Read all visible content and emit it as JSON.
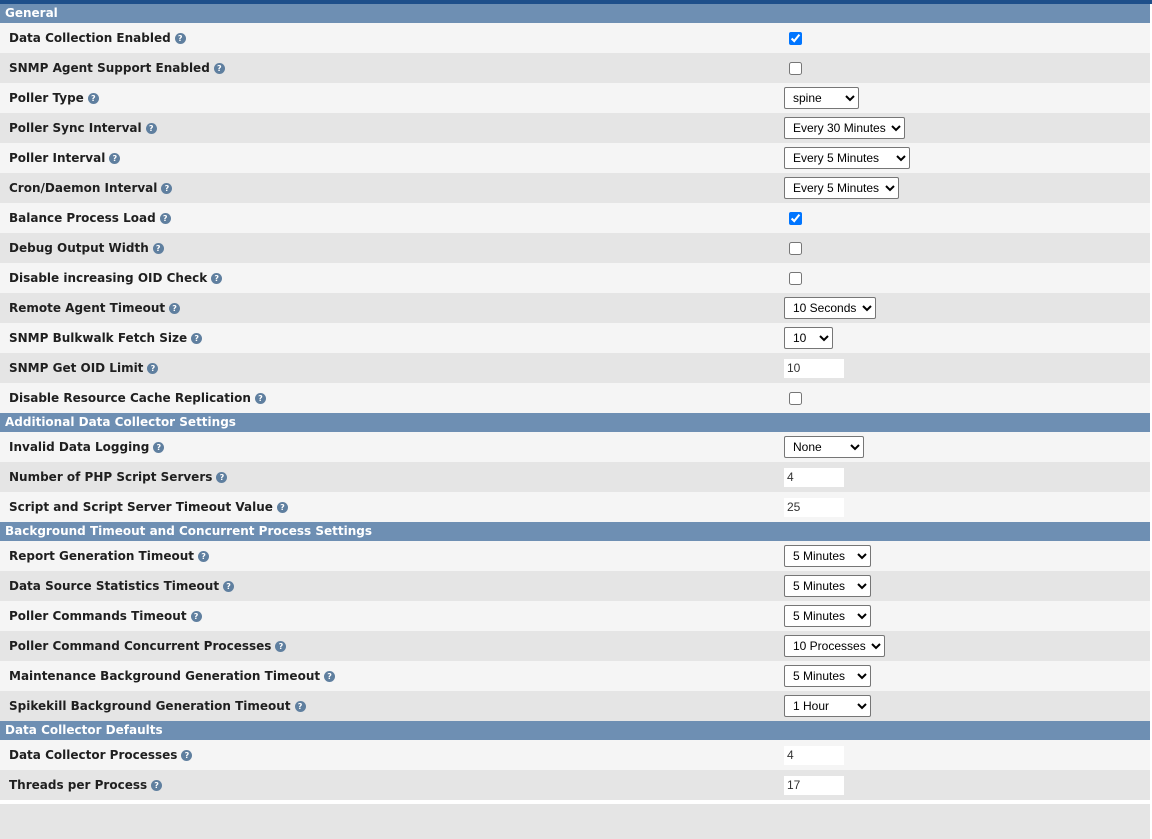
{
  "sections": [
    {
      "title": "General"
    },
    {
      "title": "Additional Data Collector Settings"
    },
    {
      "title": "Background Timeout and Concurrent Process Settings"
    },
    {
      "title": "Data Collector Defaults"
    }
  ],
  "general": {
    "data_collection_enabled": {
      "label": "Data Collection Enabled",
      "checked": true
    },
    "snmp_agent_support": {
      "label": "SNMP Agent Support Enabled",
      "checked": false
    },
    "poller_type": {
      "label": "Poller Type",
      "value": "spine"
    },
    "poller_sync_interval": {
      "label": "Poller Sync Interval",
      "value": "Every 30 Minutes"
    },
    "poller_interval": {
      "label": "Poller Interval",
      "value": "Every 5 Minutes"
    },
    "cron_interval": {
      "label": "Cron/Daemon Interval",
      "value": "Every 5 Minutes"
    },
    "balance_process_load": {
      "label": "Balance Process Load",
      "checked": true
    },
    "debug_output_width": {
      "label": "Debug Output Width",
      "checked": false
    },
    "disable_oid_check": {
      "label": "Disable increasing OID Check",
      "checked": false
    },
    "remote_agent_timeout": {
      "label": "Remote Agent Timeout",
      "value": "10 Seconds"
    },
    "snmp_bulkwalk_size": {
      "label": "SNMP Bulkwalk Fetch Size",
      "value": "10"
    },
    "snmp_get_oid_limit": {
      "label": "SNMP Get OID Limit",
      "value": "10"
    },
    "disable_resource_cache": {
      "label": "Disable Resource Cache Replication",
      "checked": false
    }
  },
  "additional": {
    "invalid_data_logging": {
      "label": "Invalid Data Logging",
      "value": "None"
    },
    "php_script_servers": {
      "label": "Number of PHP Script Servers",
      "value": "4"
    },
    "script_timeout": {
      "label": "Script and Script Server Timeout Value",
      "value": "25"
    }
  },
  "background": {
    "report_gen_timeout": {
      "label": "Report Generation Timeout",
      "value": "5 Minutes"
    },
    "ds_stats_timeout": {
      "label": "Data Source Statistics Timeout",
      "value": "5 Minutes"
    },
    "poller_cmd_timeout": {
      "label": "Poller Commands Timeout",
      "value": "5 Minutes"
    },
    "poller_cmd_processes": {
      "label": "Poller Command Concurrent Processes",
      "value": "10 Processes"
    },
    "maint_bg_timeout": {
      "label": "Maintenance Background Generation Timeout",
      "value": "5 Minutes"
    },
    "spikekill_bg_timeout": {
      "label": "Spikekill Background Generation Timeout",
      "value": "1 Hour"
    }
  },
  "defaults": {
    "collector_processes": {
      "label": "Data Collector Processes",
      "value": "4"
    },
    "threads_per_process": {
      "label": "Threads per Process",
      "value": "17"
    }
  },
  "help_icon_glyph": "?"
}
